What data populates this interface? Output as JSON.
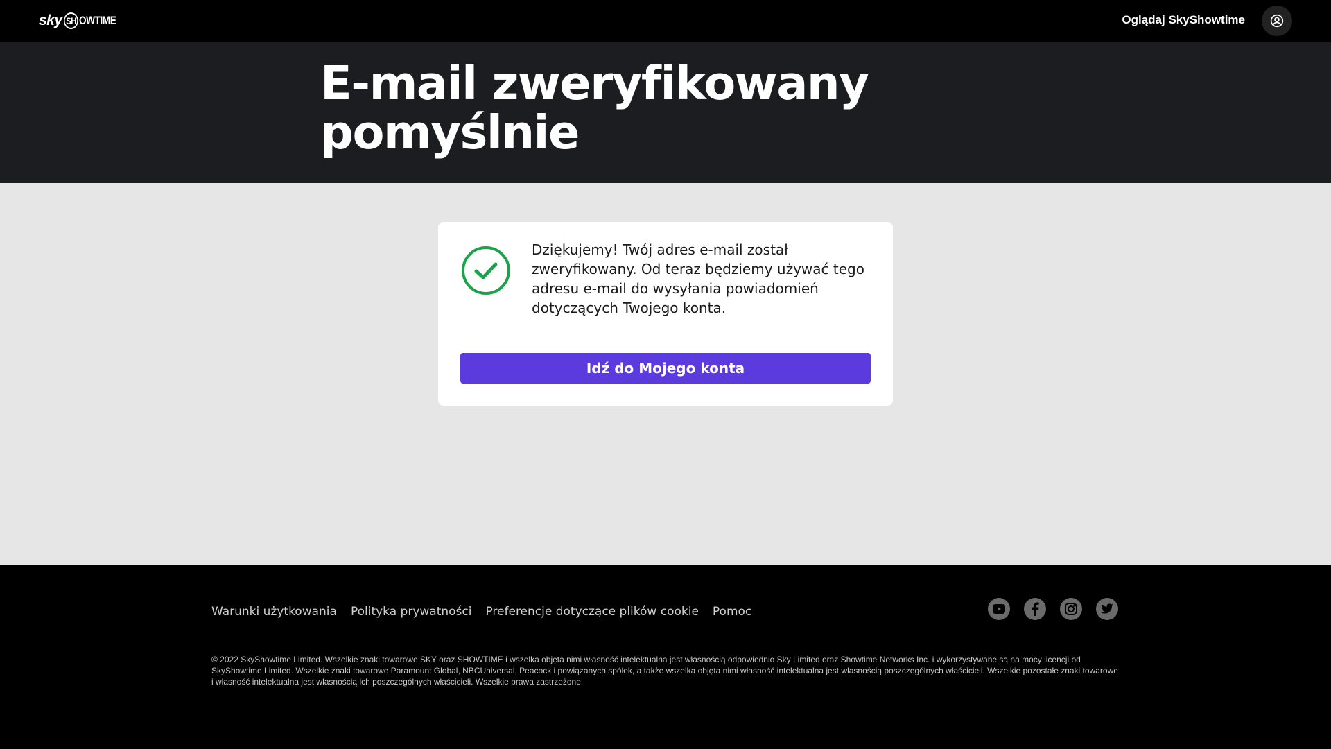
{
  "header": {
    "logo_text_sky": "sky",
    "logo_text_showtime_sh": "SH",
    "logo_text_showtime_rest": "OWTIME",
    "watch_link": "Oglądaj SkyShowtime",
    "account_icon": "user-circle-icon"
  },
  "hero": {
    "title": "E-mail zweryfikowany pomyślnie"
  },
  "card": {
    "status_icon": "check-circle-icon",
    "status_color": "#1aa34a",
    "message": "Dziękujemy! Twój adres e-mail został zweryfikowany. Od teraz będziemy używać tego adresu e-mail do wysyłania powiadomień dotyczących Twojego konta.",
    "button_label": "Idź do Mojego konta",
    "button_color": "#5b3bdd"
  },
  "footer": {
    "links": [
      {
        "label": "Warunki użytkowania"
      },
      {
        "label": "Polityka prywatności"
      },
      {
        "label": "Preferencje dotyczące plików cookie"
      },
      {
        "label": "Pomoc"
      }
    ],
    "social_icons": [
      "youtube-icon",
      "facebook-icon",
      "instagram-icon",
      "twitter-icon"
    ],
    "legal": "© 2022 SkyShowtime Limited. Wszelkie znaki towarowe SKY oraz SHOWTIME i wszelka objęta nimi własność intelektualna jest własnością odpowiednio Sky Limited oraz Showtime Networks Inc. i wykorzystywane są na mocy licencji od SkyShowtime Limited. Wszelkie znaki towarowe Paramount Global, NBCUniversal, Peacock i powiązanych spółek, a także wszelka objęta nimi własność intelektualna jest własnością poszczególnych właścicieli. Wszelkie pozostałe znaki towarowe i własność intelektualna jest własnością ich poszczególnych właścicieli. Wszelkie prawa zastrzeżone."
  }
}
